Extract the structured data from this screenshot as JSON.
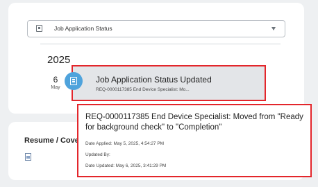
{
  "dropdown": {
    "label": "Job Application Status",
    "icon": "document-icon",
    "caret_icon": "chevron-down-icon"
  },
  "timeline": {
    "year": "2025",
    "entry": {
      "day": "6",
      "month": "May",
      "dot_icon": "document-icon",
      "title": "Job Application Status Updated",
      "subtitle": "REQ-0000117385 End Device Specialist: Mo..."
    }
  },
  "popup": {
    "description": "REQ-0000117385 End Device Specialist: Moved from \"Ready for background check\" to \"Completion\"",
    "date_applied": "Date Applied: May 5, 2025, 4:54:27 PM",
    "updated_by": "Updated By:",
    "date_updated": "Date Updated: May 6, 2025, 3:41:29 PM"
  },
  "resume": {
    "label": "Resume / Cover",
    "icon": "document-icon"
  },
  "colors": {
    "highlight_border": "#e3262b",
    "timeline_dot": "#4fa3dc",
    "background": "#eef0f2"
  }
}
